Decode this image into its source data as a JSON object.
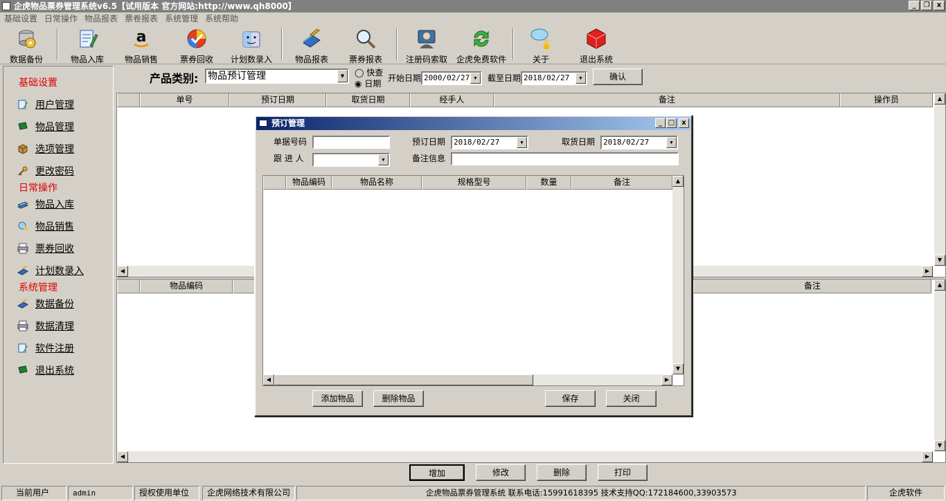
{
  "app": {
    "title": "企虎物品票券管理系统v6.5【试用版本 官方网站:http://www.qh8000】",
    "win_min": "_",
    "win_restore": "❐",
    "win_close": "x"
  },
  "menu": [
    "基础设置",
    "日常操作",
    "物品报表",
    "票卷报表",
    "系统管理",
    "系统帮助"
  ],
  "toolbar": [
    {
      "label": "数据备份",
      "icon": "database-disc-icon"
    },
    {
      "label": "物品入库",
      "icon": "notepad-pencil-icon"
    },
    {
      "label": "物品销售",
      "icon": "amazon-a-icon"
    },
    {
      "label": "票券回收",
      "icon": "check-badge-icon"
    },
    {
      "label": "计划数录入",
      "icon": "finder-face-icon"
    },
    {
      "label": "物品报表",
      "icon": "book-pen-icon"
    },
    {
      "label": "票券报表",
      "icon": "magnifier-icon"
    },
    {
      "label": "注册码索取",
      "icon": "support-agent-icon"
    },
    {
      "label": "企虎免费软件",
      "icon": "refresh-arrows-icon"
    },
    {
      "label": "关于",
      "icon": "chat-person-icon"
    },
    {
      "label": "退出系统",
      "icon": "red-cube-icon"
    }
  ],
  "sidebar": {
    "sections": [
      {
        "title": "基础设置",
        "items": [
          {
            "label": "用户管理",
            "icon": "user-doc-icon"
          },
          {
            "label": "物品管理",
            "icon": "green-flag-icon"
          },
          {
            "label": "选项管理",
            "icon": "box-icon"
          },
          {
            "label": "更改密码",
            "icon": "key-icon"
          }
        ]
      },
      {
        "title": "日常操作",
        "items": [
          {
            "label": "物品入库",
            "icon": "stack-icon"
          },
          {
            "label": "物品销售",
            "icon": "globe-person-icon"
          },
          {
            "label": "票券回收",
            "icon": "printer-icon"
          },
          {
            "label": "计划数录入",
            "icon": "book-pen-icon"
          }
        ]
      },
      {
        "title": "系统管理",
        "items": [
          {
            "label": "数据备份",
            "icon": "book-pen-icon"
          },
          {
            "label": "数据清理",
            "icon": "printer-icon"
          },
          {
            "label": "软件注册",
            "icon": "user-doc-icon"
          },
          {
            "label": "退出系统",
            "icon": "green-flag-icon"
          }
        ]
      }
    ]
  },
  "filter": {
    "category_label": "产品类别:",
    "category_value": "物品预订管理",
    "radio_quick": "快查",
    "radio_date": "日期",
    "start_label": "开始日期",
    "start_value": "2000/02/27",
    "end_label": "截至日期",
    "end_value": "2018/02/27",
    "confirm": "确认"
  },
  "grid_top": {
    "columns": [
      "",
      "单号",
      "预订日期",
      "取货日期",
      "经手人",
      "备注",
      "操作员"
    ]
  },
  "grid_bottom": {
    "columns": [
      "",
      "物品编码",
      "备注"
    ]
  },
  "dialog": {
    "title": "预订管理",
    "doc_no_label": "单据号码",
    "doc_no_value": "",
    "order_date_label": "预订日期",
    "order_date_value": "2018/02/27",
    "pickup_date_label": "取货日期",
    "pickup_date_value": "2018/02/27",
    "follower_label": "跟 进 人",
    "follower_value": "",
    "remark_label": "备注信息",
    "remark_value": "",
    "columns": [
      "",
      "物品编码",
      "物品名称",
      "规格型号",
      "数量",
      "备注"
    ],
    "add_item": "添加物品",
    "delete_item": "删除物品",
    "save": "保存",
    "close": "关闭"
  },
  "actions": {
    "add": "增加",
    "edit": "修改",
    "delete": "删除",
    "print": "打印"
  },
  "status": {
    "user_label": "当前用户",
    "user_value": "admin",
    "licensee_label": "授权使用单位",
    "licensee_value": "企虎网络技术有限公司",
    "info": "企虎物品票券管理系统  联系电话:15991618395  技术支持QQ:172184600,33903573",
    "brand": "企虎软件"
  }
}
